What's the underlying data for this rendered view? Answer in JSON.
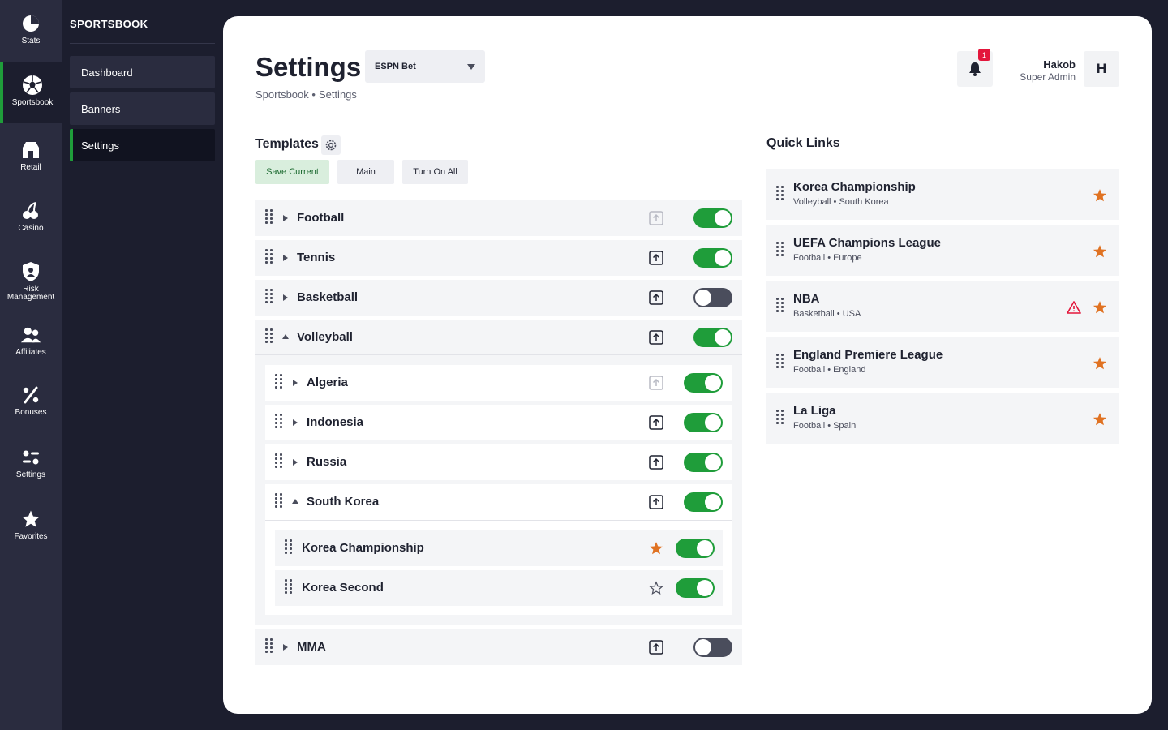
{
  "rail": [
    {
      "label": "Stats",
      "icon": "stats-icon"
    },
    {
      "label": "Sportsbook",
      "icon": "soccer-ball-icon"
    },
    {
      "label": "Retail",
      "icon": "store-icon"
    },
    {
      "label": "Casino",
      "icon": "cherries-icon"
    },
    {
      "label": "Risk Management",
      "icon": "shield-icon"
    },
    {
      "label": "Affiliates",
      "icon": "people-icon"
    },
    {
      "label": "Bonuses",
      "icon": "percent-icon"
    },
    {
      "label": "Settings",
      "icon": "sliders-icon"
    },
    {
      "label": "Favorites",
      "icon": "star-icon"
    }
  ],
  "submenu": {
    "title": "SPORTSBOOK",
    "items": [
      "Dashboard",
      "Banners",
      "Settings"
    ],
    "active": "Settings"
  },
  "header": {
    "title": "Settings",
    "brand_select": "ESPN Bet",
    "breadcrumb": [
      "Sportsbook •",
      "Settings"
    ],
    "notifications": "1",
    "user_name": "Hakob",
    "user_role": "Super Admin",
    "avatar": "H"
  },
  "templates": {
    "title": "Templates",
    "buttons": [
      "Save Current",
      "Main",
      "Turn On All"
    ]
  },
  "sports": [
    {
      "name": "Football",
      "enabled": true,
      "upload_active": false,
      "expanded": false
    },
    {
      "name": "Tennis",
      "enabled": true,
      "upload_active": true,
      "expanded": false
    },
    {
      "name": "Basketball",
      "enabled": false,
      "upload_active": true,
      "expanded": false
    },
    {
      "name": "Volleyball",
      "enabled": true,
      "upload_active": true,
      "expanded": true,
      "countries": [
        {
          "name": "Algeria",
          "enabled": true,
          "upload_active": false,
          "expanded": false
        },
        {
          "name": "Indonesia",
          "enabled": true,
          "upload_active": true,
          "expanded": false
        },
        {
          "name": "Russia",
          "enabled": true,
          "upload_active": true,
          "expanded": false
        },
        {
          "name": "South Korea",
          "enabled": true,
          "upload_active": true,
          "expanded": true,
          "leagues": [
            {
              "name": "Korea Championship",
              "enabled": true,
              "favorite": true
            },
            {
              "name": "Korea Second",
              "enabled": true,
              "favorite": false
            }
          ]
        }
      ]
    },
    {
      "name": "MMA",
      "enabled": false,
      "upload_active": true,
      "expanded": false
    }
  ],
  "quick_links": {
    "title": "Quick Links",
    "items": [
      {
        "name": "Korea Championship",
        "sub": "Volleyball • South Korea",
        "warning": false
      },
      {
        "name": "UEFA Champions League",
        "sub": "Football • Europe",
        "warning": false
      },
      {
        "name": "NBA",
        "sub": "Basketball • USA",
        "warning": true
      },
      {
        "name": "England Premiere League",
        "sub": "Football • England",
        "warning": false
      },
      {
        "name": "La Liga",
        "sub": "Football • Spain",
        "warning": false
      }
    ]
  },
  "colors": {
    "accent": "#1f9d3a",
    "star": "#e07222",
    "warning": "#e3163b",
    "rail_bg": "#2a2c3f",
    "page_bg": "#1c1e2e"
  }
}
